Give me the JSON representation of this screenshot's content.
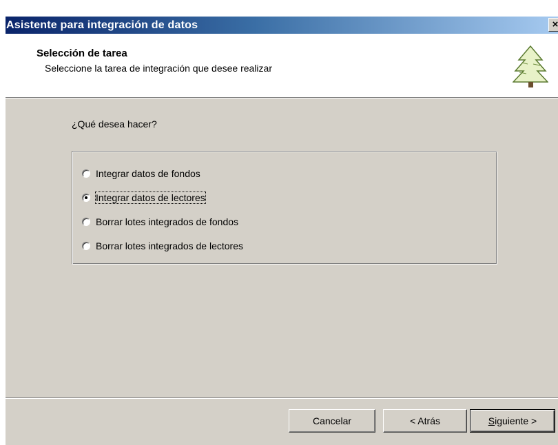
{
  "window": {
    "title": "Asistente para integración de datos",
    "close_glyph": "×"
  },
  "header": {
    "title": "Selección de tarea",
    "subtitle": "Seleccione la tarea de integración que desee realizar",
    "icon": "tree-icon"
  },
  "main": {
    "question": "¿Qué desea hacer?",
    "options": [
      {
        "label": "Integrar datos de fondos",
        "selected": false
      },
      {
        "label": "Integrar datos de lectores",
        "selected": true
      },
      {
        "label": "Borrar lotes integrados de fondos",
        "selected": false
      },
      {
        "label": "Borrar lotes integrados de lectores",
        "selected": false
      }
    ]
  },
  "buttons": {
    "cancel": "Cancelar",
    "back": "< Atrás",
    "next_mnemonic": "S",
    "next_rest": "iguiente >"
  },
  "colors": {
    "titlebar_start": "#0a246a",
    "titlebar_end": "#a6caf0",
    "face": "#d4d0c8",
    "header_bg": "#ffffff"
  }
}
